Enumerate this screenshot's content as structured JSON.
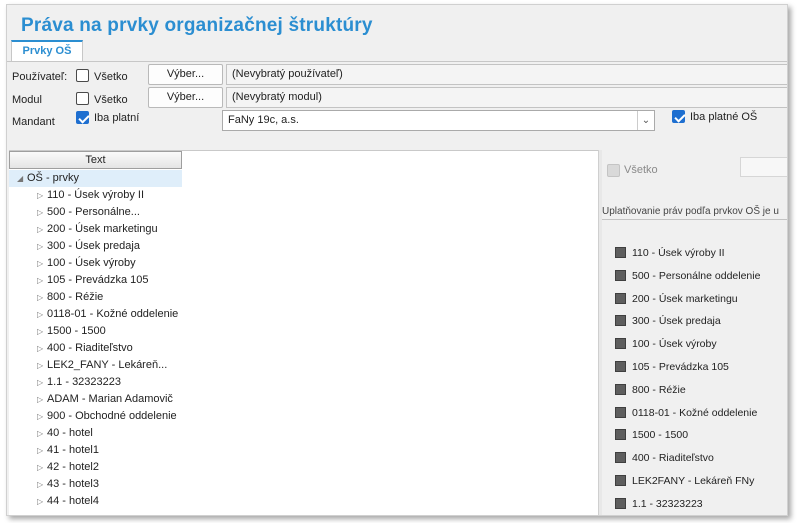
{
  "window": {
    "title": "Práva na prvky organizačnej štruktúry"
  },
  "tabs": [
    {
      "label": "Prvky OŠ"
    }
  ],
  "filters": {
    "user": {
      "label": "Používateľ:",
      "all_label": "Všetko",
      "pick_label": "Výber...",
      "value": "(Nevybratý používateľ)"
    },
    "module": {
      "label": "Modul",
      "all_label": "Všetko",
      "pick_label": "Výber...",
      "value": "(Nevybratý modul)"
    },
    "mandant": {
      "label": "Mandant",
      "only_valid_label": "Iba platní",
      "selected": "FaNy 19c, a.s.",
      "only_valid_os_label": "Iba platné OŠ"
    }
  },
  "tree": {
    "column_header": "Text",
    "root": "OŠ - prvky",
    "items": [
      "110 - Úsek výroby II",
      "500 - Personálne...",
      "200 - Úsek marketingu",
      "300 - Úsek predaja",
      "100 - Úsek výroby",
      "105 - Prevádzka 105",
      "800 - Réžie",
      "0118-01 - Kožné oddelenie",
      "1500 - 1500",
      "400 - Riaditeľstvo",
      "LEK2_FANY -  Lekáreň...",
      "1.1 - 32323223",
      "ADAM - Marian Adamovič",
      "900 - Obchodné oddelenie",
      "40 - hotel",
      "41 - hotel1",
      "42 - hotel2",
      "43 - hotel3",
      "44 - hotel4"
    ]
  },
  "rights_panel": {
    "all_label": "Všetko",
    "header": "Uplatňovanie práv podľa prvkov OŠ je u",
    "items": [
      "110 - Úsek výroby II",
      "500 - Personálne oddelenie",
      "200 - Úsek marketingu",
      "300 - Úsek predaja",
      "100 - Úsek výroby",
      "105 - Prevádzka 105",
      "800 - Réžie",
      "0118-01 - Kožné oddelenie",
      "1500 - 1500",
      "400 - Riaditeľstvo",
      "LEK2FANY - Lekáreň FNy",
      "1.1 - 32323223"
    ]
  },
  "colors": {
    "accent": "#2b8ed1",
    "checkbox_checked": "#1e6fd0",
    "selection": "#dfeefa"
  },
  "icons": {
    "expander": "triangle-right-icon",
    "root_expander": "triangle-down-icon",
    "combo_arrow": "chevron-down-icon"
  }
}
